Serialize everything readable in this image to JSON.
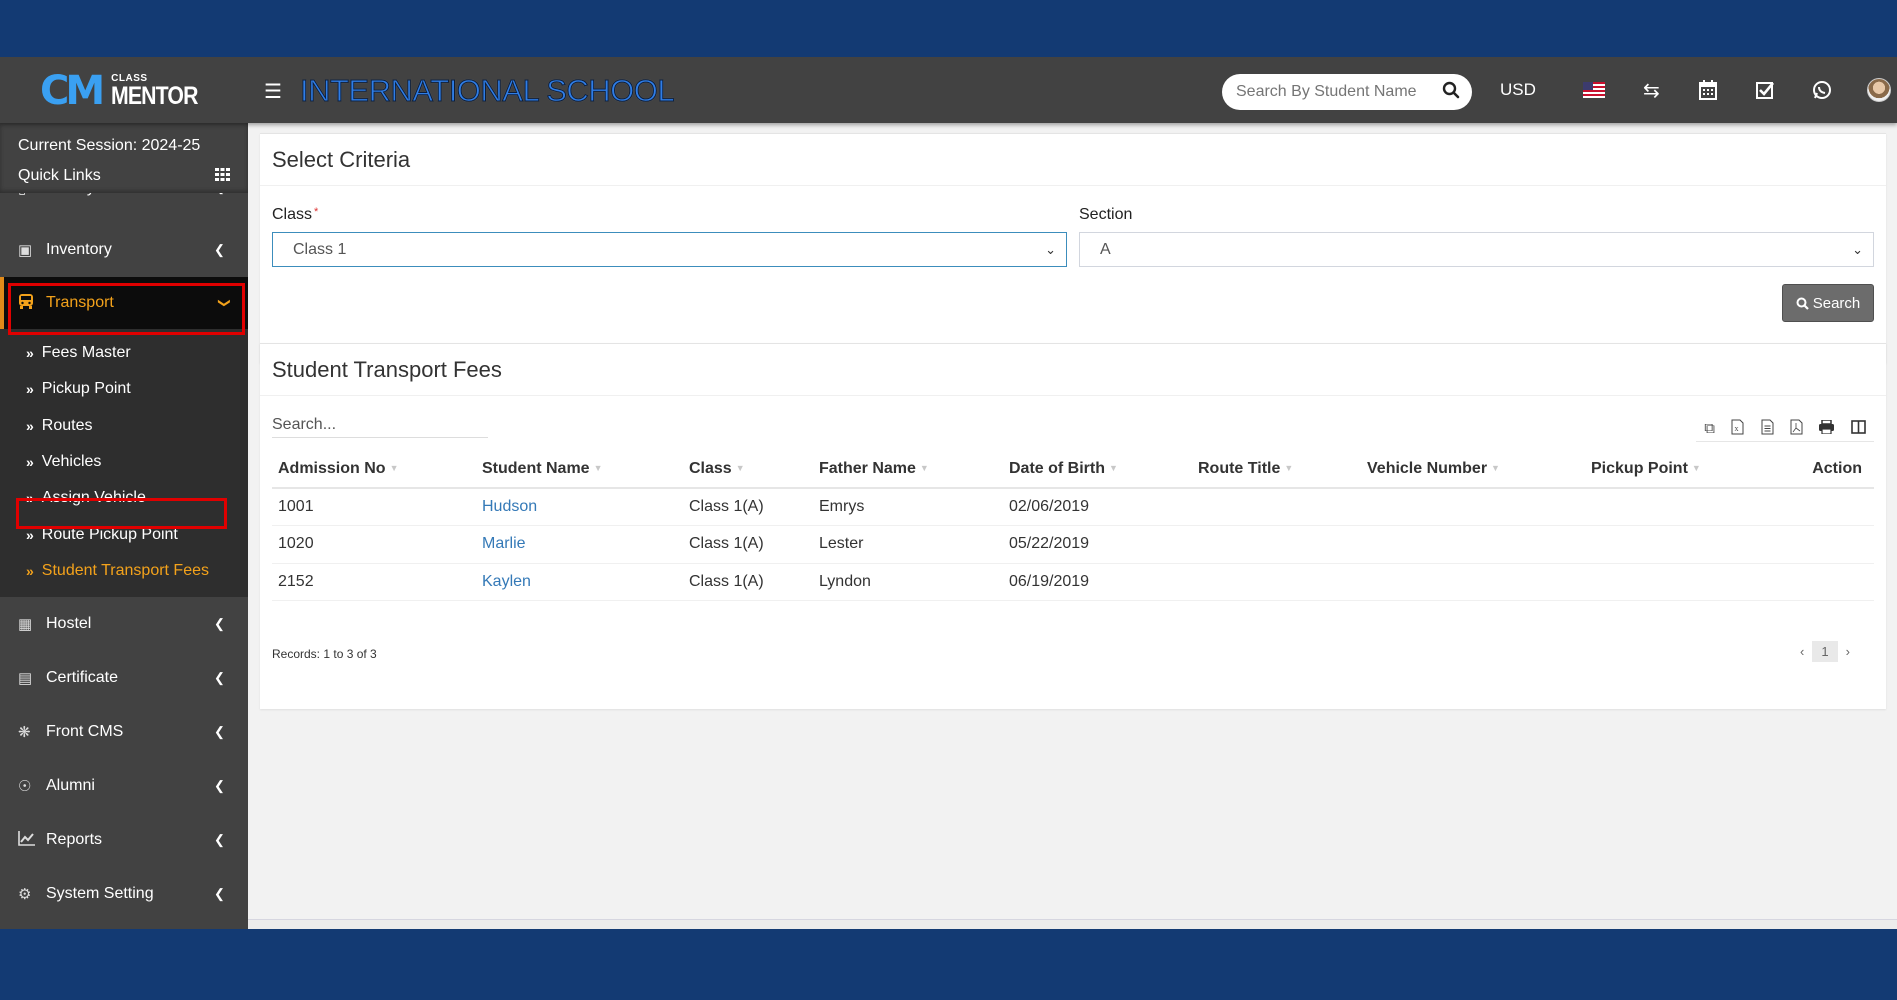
{
  "header": {
    "logo_small": "CLASS",
    "logo_big": "MENTOR",
    "logo_mark": "CM",
    "school_name": "INTERNATIONAL SCHOOL",
    "search_placeholder": "Search By Student Name",
    "currency": "USD",
    "icons": [
      "menu-icon",
      "search-icon",
      "us-flag-icon",
      "exchange-icon",
      "calendar-icon",
      "check-square-icon",
      "whatsapp-icon",
      "user-avatar"
    ]
  },
  "sidebar": {
    "session": "Current Session: 2024-25",
    "quick_links": "Quick Links",
    "items_top": [
      {
        "label": "Library",
        "icon": "book-icon"
      },
      {
        "label": "Inventory",
        "icon": "inventory-icon"
      }
    ],
    "active": {
      "label": "Transport",
      "icon": "bus-icon"
    },
    "submenu": [
      {
        "label": "Fees Master"
      },
      {
        "label": "Pickup Point"
      },
      {
        "label": "Routes"
      },
      {
        "label": "Vehicles"
      },
      {
        "label": "Assign Vehicle"
      },
      {
        "label": "Route Pickup Point"
      },
      {
        "label": "Student Transport Fees"
      }
    ],
    "items_bottom": [
      {
        "label": "Hostel",
        "icon": "building-icon"
      },
      {
        "label": "Certificate",
        "icon": "certificate-icon"
      },
      {
        "label": "Front CMS",
        "icon": "cms-icon"
      },
      {
        "label": "Alumni",
        "icon": "alumni-icon"
      },
      {
        "label": "Reports",
        "icon": "chart-icon"
      },
      {
        "label": "System Setting",
        "icon": "gears-icon"
      }
    ]
  },
  "criteria": {
    "title": "Select Criteria",
    "class_label": "Class",
    "required_mark": "*",
    "class_value": "Class 1",
    "section_label": "Section",
    "section_value": "A",
    "search_button": "Search"
  },
  "fees": {
    "title": "Student Transport Fees",
    "search_placeholder": "Search...",
    "export_buttons": [
      "copy-icon",
      "excel-icon",
      "csv-icon",
      "pdf-icon",
      "print-icon",
      "columns-icon"
    ],
    "columns": [
      "Admission No",
      "Student Name",
      "Class",
      "Father Name",
      "Date of Birth",
      "Route Title",
      "Vehicle Number",
      "Pickup Point",
      "Action"
    ],
    "rows": [
      {
        "admission_no": "1001",
        "student_name": "Hudson",
        "class": "Class 1(A)",
        "father_name": "Emrys",
        "dob": "02/06/2019",
        "route_title": "",
        "vehicle_number": "",
        "pickup_point": "",
        "action": ""
      },
      {
        "admission_no": "1020",
        "student_name": "Marlie",
        "class": "Class 1(A)",
        "father_name": "Lester",
        "dob": "05/22/2019",
        "route_title": "",
        "vehicle_number": "",
        "pickup_point": "",
        "action": ""
      },
      {
        "admission_no": "2152",
        "student_name": "Kaylen",
        "class": "Class 1(A)",
        "father_name": "Lyndon",
        "dob": "06/19/2019",
        "route_title": "",
        "vehicle_number": "",
        "pickup_point": "",
        "action": ""
      }
    ],
    "records": "Records: 1 to 3 of 3",
    "page": "1",
    "prev": "‹",
    "next": "›"
  },
  "colors": {
    "brand_blue": "#133a73",
    "header_bg": "#424242",
    "active_orange": "#f3a21b",
    "link_blue": "#3479b7",
    "highlight_red": "#e00000"
  }
}
